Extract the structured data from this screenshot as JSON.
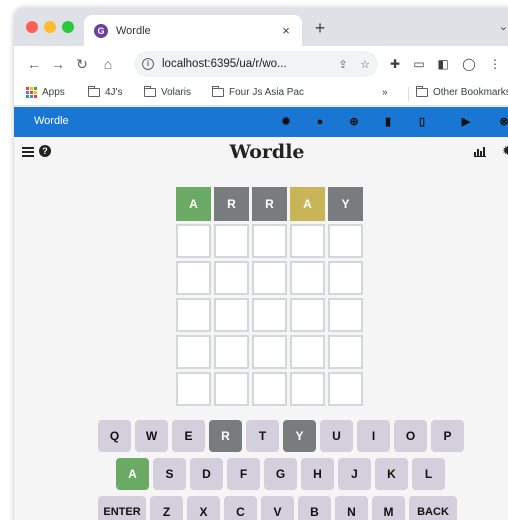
{
  "browser": {
    "tab_title": "Wordle",
    "tab_favicon_letter": "G",
    "close_glyph": "×",
    "new_tab_glyph": "+",
    "overflow_glyph": "⌄",
    "url": "localhost:6395/ua/r/wo...",
    "bookmarks": [
      {
        "label": "Apps",
        "icon": "apps-grid-icon"
      },
      {
        "label": "4J's",
        "icon": "folder-icon"
      },
      {
        "label": "Volaris",
        "icon": "folder-icon"
      },
      {
        "label": "Four Js Asia Pac",
        "icon": "folder-icon"
      },
      {
        "label": "»",
        "icon": ""
      },
      {
        "label": "Other Bookmarks",
        "icon": "folder-icon"
      }
    ]
  },
  "app_toolbar": {
    "title": "Wordle",
    "icons": [
      "gear-icon",
      "info-icon",
      "globe-icon",
      "document-icon",
      "file-icon",
      "play-icon",
      "close-icon"
    ]
  },
  "game": {
    "title": "Wordle",
    "board": [
      [
        {
          "letter": "A",
          "state": "correct"
        },
        {
          "letter": "R",
          "state": "absent"
        },
        {
          "letter": "R",
          "state": "absent"
        },
        {
          "letter": "A",
          "state": "present"
        },
        {
          "letter": "Y",
          "state": "absent"
        }
      ],
      [
        {
          "letter": "",
          "state": "empty"
        },
        {
          "letter": "",
          "state": "empty"
        },
        {
          "letter": "",
          "state": "empty"
        },
        {
          "letter": "",
          "state": "empty"
        },
        {
          "letter": "",
          "state": "empty"
        }
      ],
      [
        {
          "letter": "",
          "state": "empty"
        },
        {
          "letter": "",
          "state": "empty"
        },
        {
          "letter": "",
          "state": "empty"
        },
        {
          "letter": "",
          "state": "empty"
        },
        {
          "letter": "",
          "state": "empty"
        }
      ],
      [
        {
          "letter": "",
          "state": "empty"
        },
        {
          "letter": "",
          "state": "empty"
        },
        {
          "letter": "",
          "state": "empty"
        },
        {
          "letter": "",
          "state": "empty"
        },
        {
          "letter": "",
          "state": "empty"
        }
      ],
      [
        {
          "letter": "",
          "state": "empty"
        },
        {
          "letter": "",
          "state": "empty"
        },
        {
          "letter": "",
          "state": "empty"
        },
        {
          "letter": "",
          "state": "empty"
        },
        {
          "letter": "",
          "state": "empty"
        }
      ],
      [
        {
          "letter": "",
          "state": "empty"
        },
        {
          "letter": "",
          "state": "empty"
        },
        {
          "letter": "",
          "state": "empty"
        },
        {
          "letter": "",
          "state": "empty"
        },
        {
          "letter": "",
          "state": "empty"
        }
      ]
    ],
    "keyboard": [
      [
        {
          "label": "Q"
        },
        {
          "label": "W"
        },
        {
          "label": "E"
        },
        {
          "label": "R",
          "state": "absent"
        },
        {
          "label": "T"
        },
        {
          "label": "Y",
          "state": "absent"
        },
        {
          "label": "U"
        },
        {
          "label": "I"
        },
        {
          "label": "O"
        },
        {
          "label": "P"
        }
      ],
      [
        {
          "label": "A",
          "state": "correct"
        },
        {
          "label": "S"
        },
        {
          "label": "D"
        },
        {
          "label": "F"
        },
        {
          "label": "G"
        },
        {
          "label": "H"
        },
        {
          "label": "J"
        },
        {
          "label": "K"
        },
        {
          "label": "L"
        }
      ],
      [
        {
          "label": "ENTER",
          "wide": true
        },
        {
          "label": "Z"
        },
        {
          "label": "X"
        },
        {
          "label": "C"
        },
        {
          "label": "V"
        },
        {
          "label": "B"
        },
        {
          "label": "N"
        },
        {
          "label": "M"
        },
        {
          "label": "BACK",
          "wide": true
        }
      ]
    ]
  },
  "colors": {
    "correct": "#6aaa64",
    "present": "#c9b458",
    "absent": "#787c7e",
    "toolbar": "#1976d2",
    "key": "#d3cfdc"
  }
}
